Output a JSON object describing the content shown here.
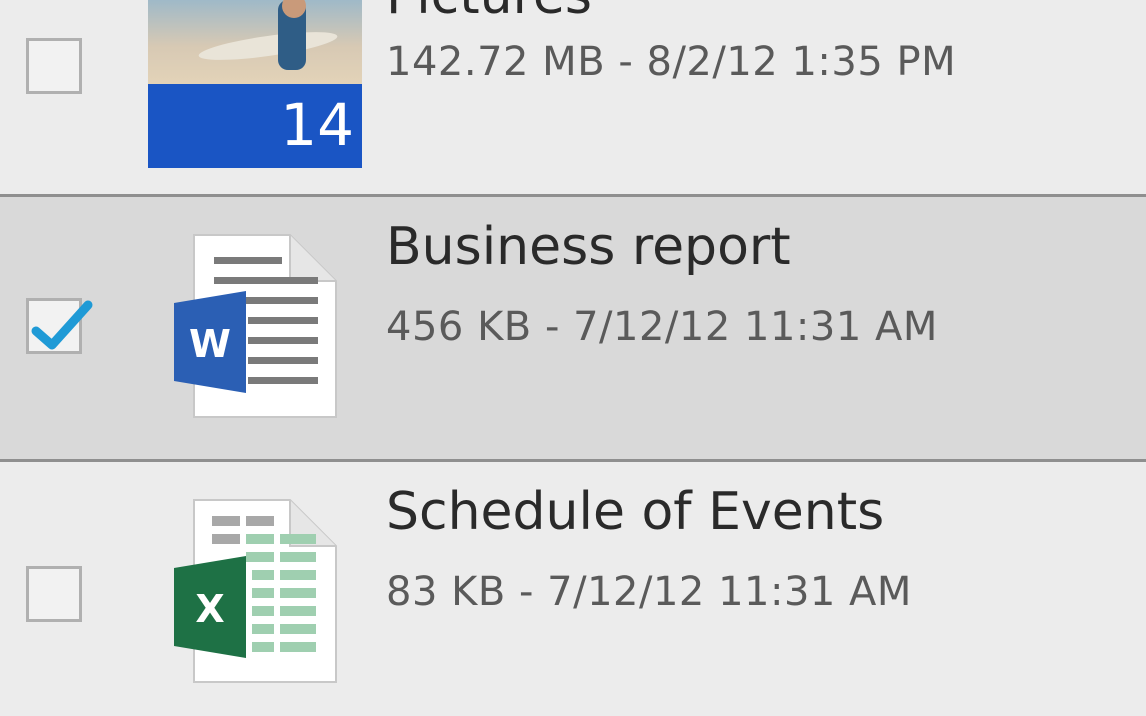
{
  "files": [
    {
      "name": "Pictures",
      "meta": "142.72 MB - 8/2/12 1:35 PM",
      "type": "folder-pictures",
      "item_count": "14",
      "checked": false,
      "icon": "pictures-thumbnail-icon"
    },
    {
      "name": "Business report",
      "meta": "456 KB - 7/12/12 11:31 AM",
      "type": "word-document",
      "checked": true,
      "icon": "word-document-icon"
    },
    {
      "name": "Schedule of Events",
      "meta": "83 KB - 7/12/12 11:31 AM",
      "type": "excel-workbook",
      "checked": false,
      "icon": "excel-workbook-icon"
    }
  ],
  "colors": {
    "word_blue": "#2b5fb4",
    "excel_green": "#1e7145",
    "checkmark_blue": "#1f9ad6",
    "selected_row": "#d9d9d9"
  }
}
